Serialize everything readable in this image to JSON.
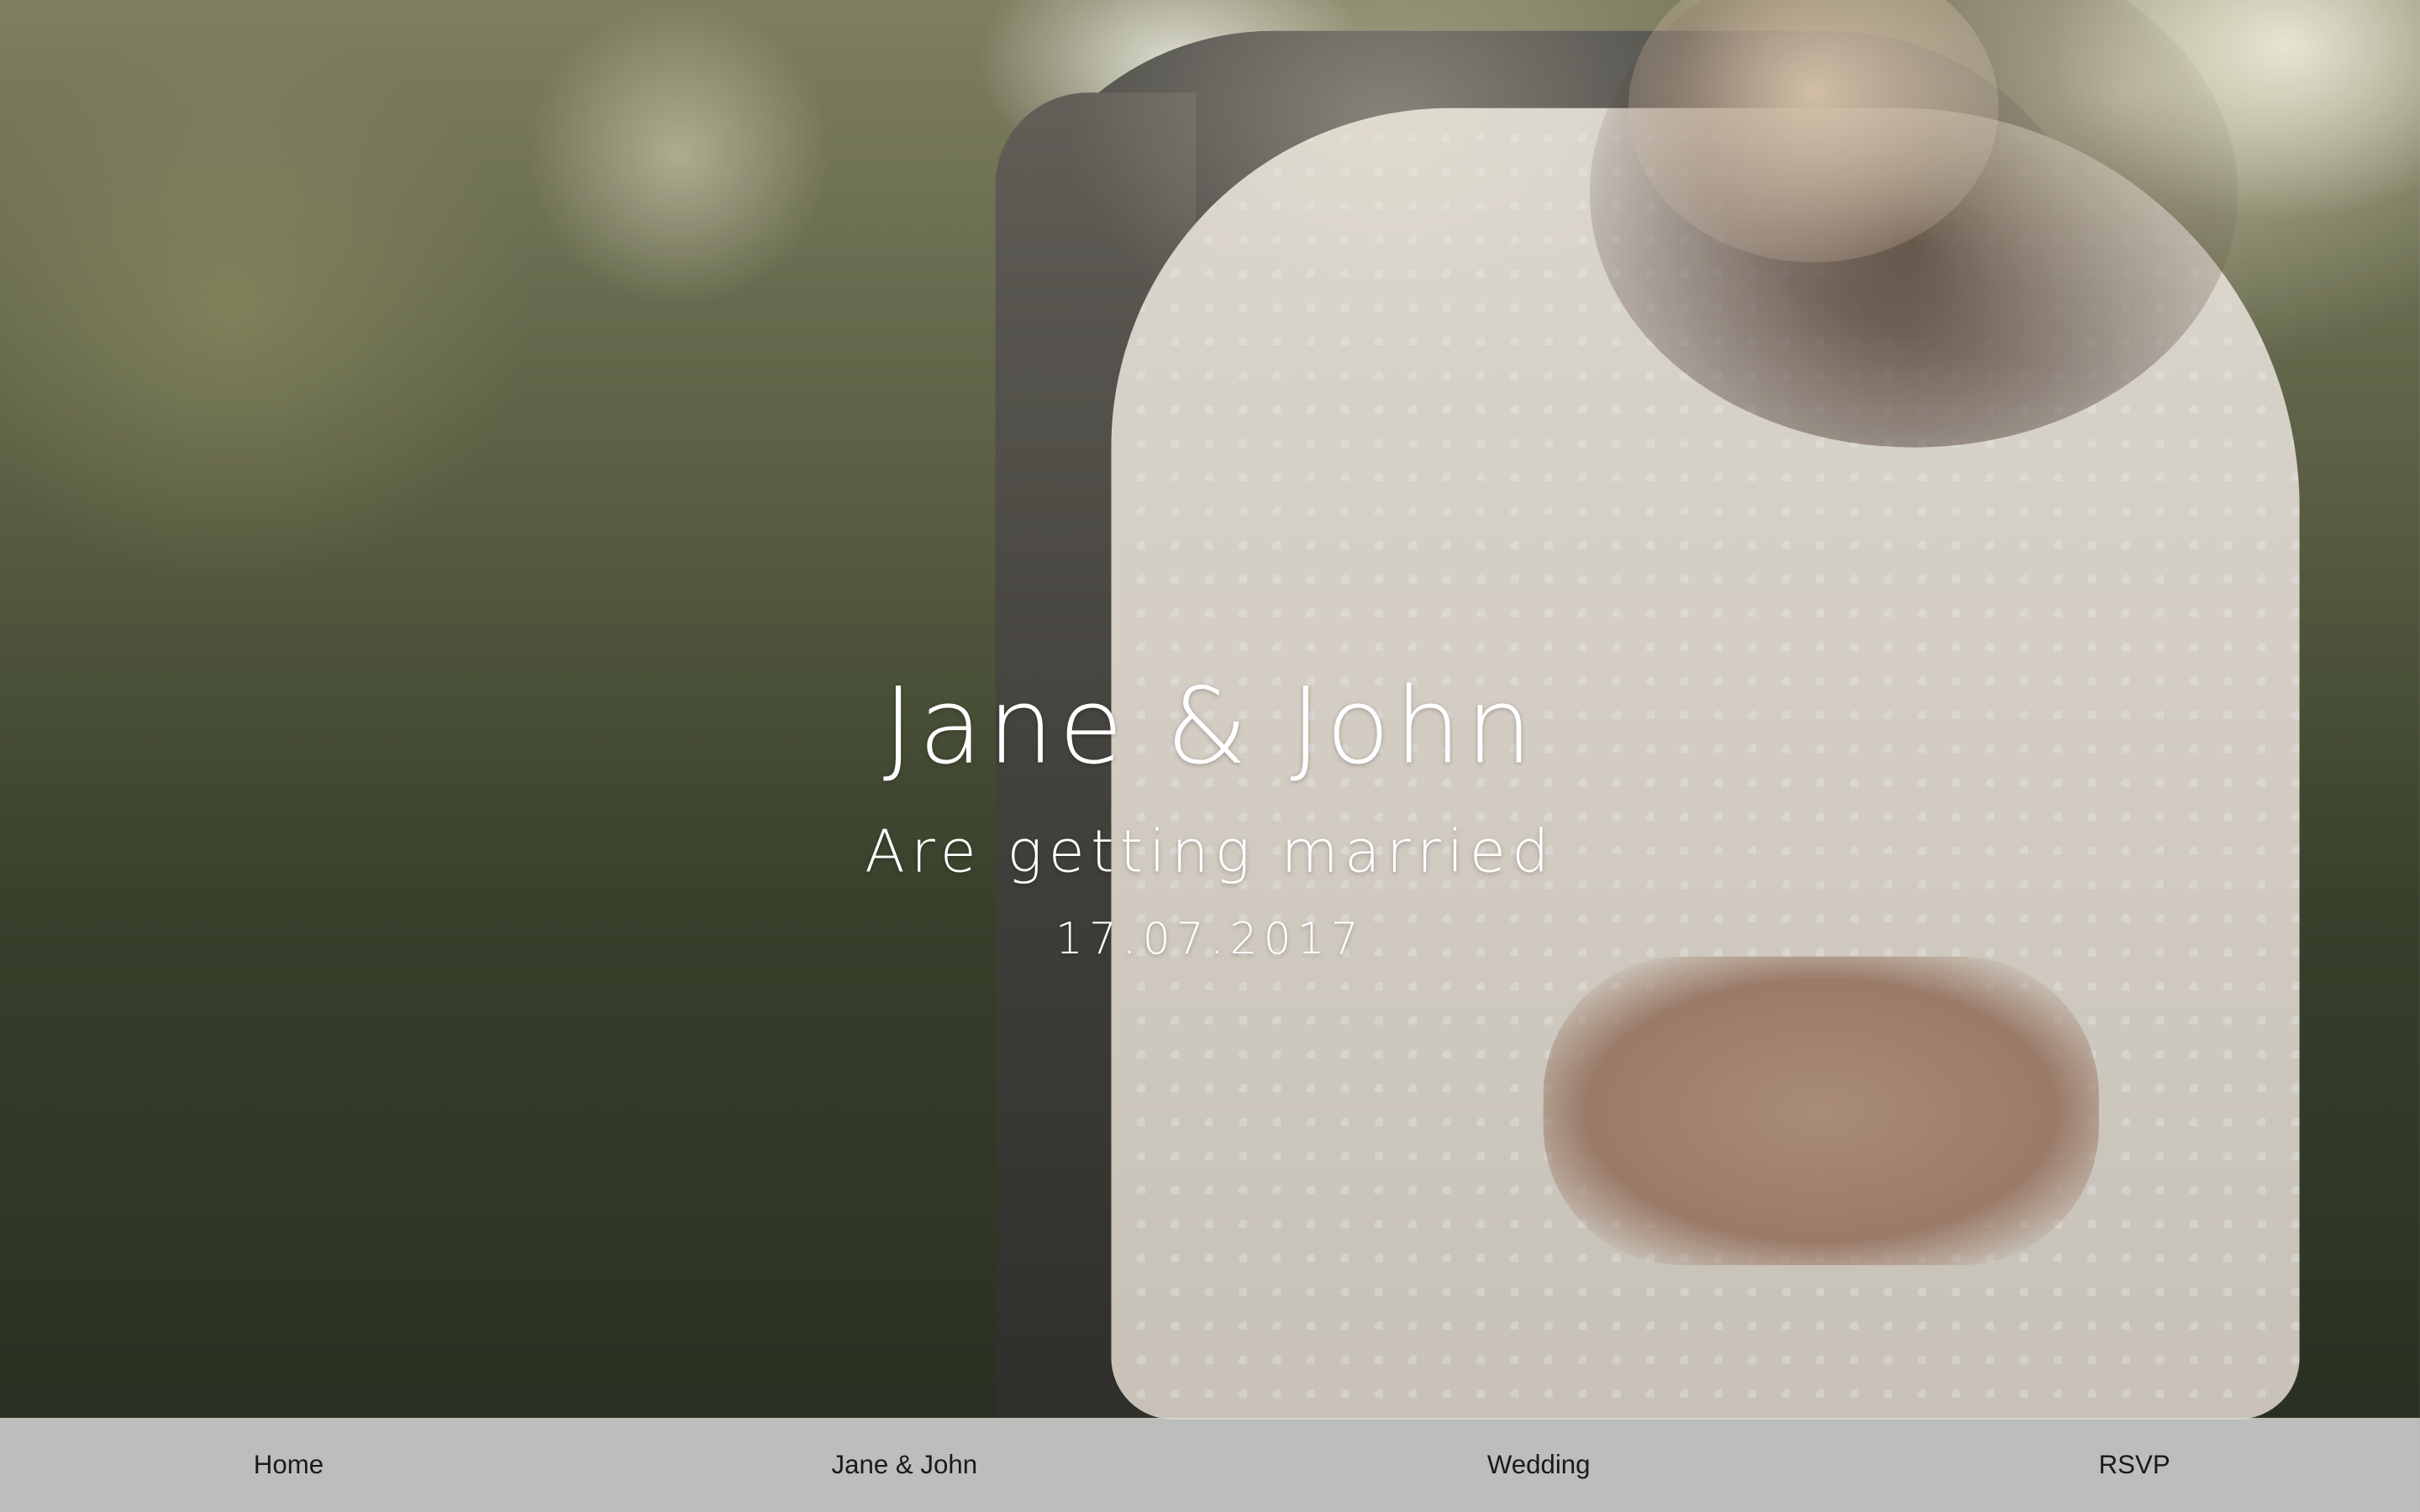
{
  "hero": {
    "title": "Jane & John",
    "subtitle": "Are getting married",
    "date": "17.07.2017"
  },
  "nav": {
    "items": [
      {
        "label": "Home"
      },
      {
        "label": "Jane & John"
      },
      {
        "label": "Wedding"
      },
      {
        "label": "RSVP"
      }
    ]
  },
  "colors": {
    "text_light": "#ffffff",
    "nav_bg": "#dedede",
    "nav_text": "#1a1a1a"
  }
}
